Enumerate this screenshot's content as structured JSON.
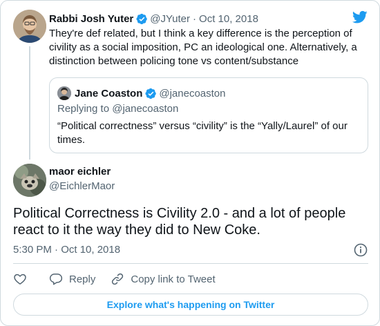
{
  "brand": {
    "accent_color": "#1d9bf0",
    "logo_icon": "twitter-bird-icon"
  },
  "parent_tweet": {
    "author_name": "Rabbi Josh Yuter",
    "handle": "@JYuter",
    "separator": "·",
    "date": "Oct 10, 2018",
    "verified": true,
    "text": "They're def related, but I think a key difference is the perception of civility as a social imposition, PC an ideological one. Alternatively, a distinction between policing tone vs  content/substance",
    "quoted_tweet": {
      "author_name": "Jane Coaston",
      "handle": "@janecoaston",
      "verified": true,
      "replying_to": "Replying to @janecoaston",
      "text": "“Political correctness” versus “civility” is the “Yally/Laurel” of our times."
    }
  },
  "main_tweet": {
    "author_name": "maor eichler",
    "handle": "@EichlerMaor",
    "text": "Political Correctness is Civility 2.0 - and a lot of people react to it the way they did to New Coke.",
    "timestamp": "5:30 PM · Oct 10, 2018"
  },
  "actions": {
    "like_icon": "heart-icon",
    "reply_label": "Reply",
    "copy_link_label": "Copy link to Tweet"
  },
  "explore_button": {
    "label": "Explore what's happening on Twitter"
  }
}
